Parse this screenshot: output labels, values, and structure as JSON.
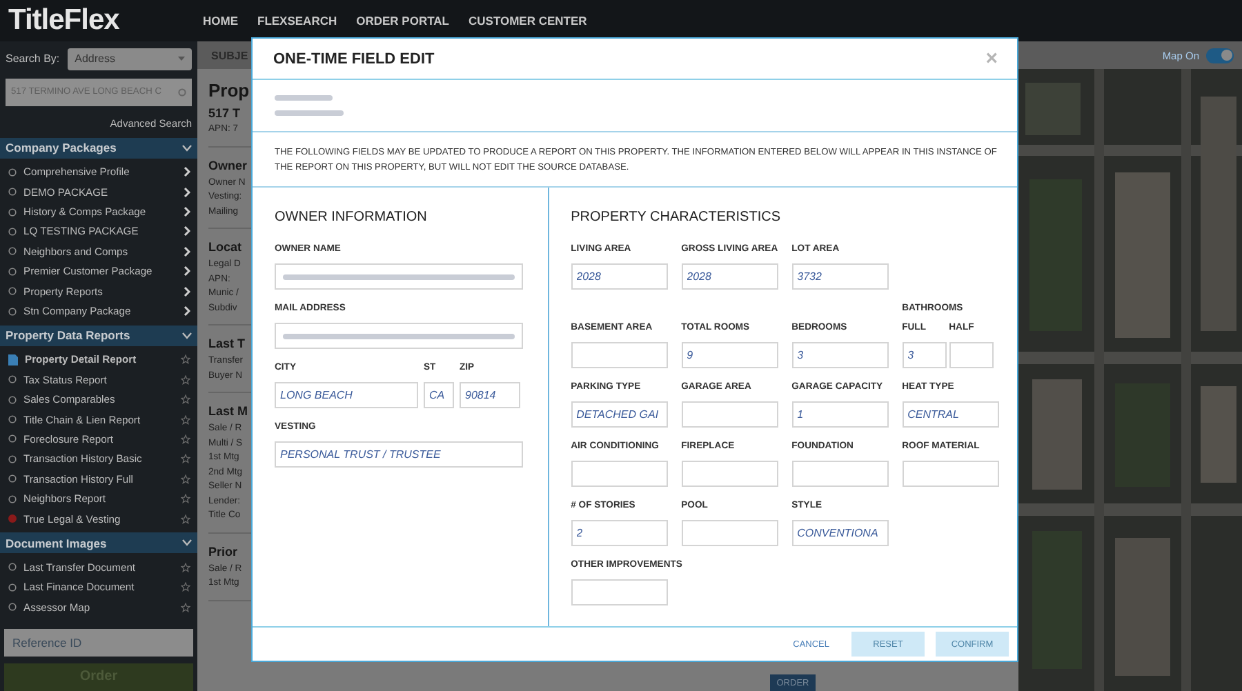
{
  "app": {
    "logo": "TitleFlex",
    "nav": [
      {
        "label": "HOME"
      },
      {
        "label": "FLEXSEARCH"
      },
      {
        "label": "ORDER PORTAL"
      },
      {
        "label": "CUSTOMER CENTER"
      }
    ]
  },
  "sidebar": {
    "search_by_label": "Search By:",
    "search_by": "Address",
    "search_value": "517 TERMINO AVE LONG BEACH C",
    "advanced_search": "Advanced Search",
    "sections": [
      {
        "title": "Company Packages",
        "expanded": true,
        "kind": "packages",
        "items": [
          {
            "label": "Comprehensive Profile",
            "kind": "circle",
            "selected": false
          },
          {
            "label": "DEMO PACKAGE",
            "kind": "circle",
            "selected": false
          },
          {
            "label": "History & Comps Package",
            "kind": "circle",
            "selected": false
          },
          {
            "label": "LQ TESTING PACKAGE",
            "kind": "circle",
            "selected": false
          },
          {
            "label": "Neighbors and Comps",
            "kind": "circle",
            "selected": false
          },
          {
            "label": "Premier Customer Package",
            "kind": "circle",
            "selected": false
          },
          {
            "label": "Property Reports",
            "kind": "circle",
            "selected": false
          },
          {
            "label": "Stn Company Package",
            "kind": "circle",
            "selected": false
          }
        ]
      },
      {
        "title": "Property Data Reports",
        "expanded": true,
        "kind": "reports",
        "items": [
          {
            "label": "Property Detail Report",
            "kind": "document",
            "selected": true
          },
          {
            "label": "Tax Status Report",
            "kind": "circle",
            "selected": false
          },
          {
            "label": "Sales Comparables",
            "kind": "circle",
            "selected": false
          },
          {
            "label": "Title Chain & Lien Report",
            "kind": "circle",
            "selected": false
          },
          {
            "label": "Foreclosure Report",
            "kind": "circle",
            "selected": false
          },
          {
            "label": "Transaction History Basic",
            "kind": "circle",
            "selected": false
          },
          {
            "label": "Transaction History Full",
            "kind": "circle",
            "selected": false
          },
          {
            "label": "Neighbors Report",
            "kind": "circle",
            "selected": false
          },
          {
            "label": "True Legal & Vesting",
            "kind": "alert",
            "selected": false
          }
        ]
      },
      {
        "title": "Document Images",
        "expanded": true,
        "kind": "reports",
        "items": [
          {
            "label": "Last Transfer Document",
            "kind": "circle",
            "selected": false
          },
          {
            "label": "Last Finance Document",
            "kind": "circle",
            "selected": false
          },
          {
            "label": "Assessor Map",
            "kind": "circle",
            "selected": false
          }
        ]
      }
    ],
    "reference_placeholder": "Reference ID",
    "order_button": "Order"
  },
  "subject_tab": "SUBJE",
  "map_toggle": {
    "label": "Map On",
    "on": true
  },
  "report_sections": [
    {
      "heading": "Prop",
      "kind": "title",
      "lines": [
        "517 T",
        "APN: 7"
      ]
    },
    {
      "heading": "Owner",
      "kind": "section",
      "lines": [
        "Owner N",
        "Vesting:",
        "Mailing"
      ]
    },
    {
      "heading": "Locat",
      "kind": "section",
      "lines": [
        "Legal D",
        "APN:",
        "Munic /",
        "Subdiv"
      ]
    },
    {
      "heading": "Last T",
      "kind": "section",
      "lines": [
        "Transfer",
        "Buyer N"
      ]
    },
    {
      "heading": "Last M",
      "kind": "section",
      "lines": [
        "Sale / R",
        "Multi / S",
        "1st Mtg",
        "2nd Mtg",
        "Seller N",
        "Lender:",
        "Title Co"
      ]
    },
    {
      "heading": "Prior",
      "kind": "section",
      "lines": [
        "Sale / R",
        "1st Mtg"
      ]
    }
  ],
  "bottom_button": "ORDER",
  "modal": {
    "title": "ONE-TIME FIELD EDIT",
    "close": "×",
    "address": [
      {
        "redacted": true
      },
      {
        "redacted": true
      }
    ],
    "notice": "THE FOLLOWING FIELDS MAY BE UPDATED TO PRODUCE A REPORT ON THIS PROPERTY. THE INFORMATION ENTERED BELOW WILL APPEAR IN THIS INSTANCE OF THE REPORT ON THIS PROPERTY, BUT WILL NOT EDIT THE SOURCE DATABASE.",
    "owner": {
      "title": "OWNER INFORMATION",
      "rows": [
        [
          {
            "label": "OWNER NAME",
            "kind": "full",
            "redacted": true
          }
        ],
        [
          {
            "label": "MAIL ADDRESS",
            "kind": "full",
            "redacted": true
          }
        ],
        [
          {
            "label": "CITY",
            "kind": "wide",
            "value": "LONG BEACH"
          },
          {
            "label": "ST",
            "kind": "tiny",
            "value": "CA"
          },
          {
            "label": "ZIP",
            "kind": "mid",
            "value": "90814"
          }
        ],
        [
          {
            "label": "VESTING",
            "kind": "full",
            "value": "PERSONAL TRUST / TRUSTEE"
          }
        ]
      ]
    },
    "property": {
      "title": "PROPERTY CHARACTERISTICS",
      "rows": [
        [
          {
            "kind": "field",
            "label": "LIVING AREA",
            "value": "2028"
          },
          {
            "kind": "field",
            "label": "GROSS LIVING AREA",
            "value": "2028"
          },
          {
            "kind": "field",
            "label": "LOT AREA",
            "value": "3732"
          }
        ],
        [
          {
            "kind": "field",
            "label": "BASEMENT AREA"
          },
          {
            "kind": "field",
            "label": "TOTAL ROOMS",
            "value": "9"
          },
          {
            "kind": "field",
            "label": "BEDROOMS",
            "value": "3"
          },
          {
            "kind": "group",
            "label": "BATHROOMS",
            "fields": [
              {
                "label": "FULL",
                "value": "3"
              },
              {
                "label": "HALF"
              }
            ]
          }
        ],
        [
          {
            "kind": "field",
            "label": "PARKING TYPE",
            "value": "DETACHED GAI"
          },
          {
            "kind": "field",
            "label": "GARAGE AREA"
          },
          {
            "kind": "field",
            "label": "GARAGE CAPACITY",
            "value": "1"
          },
          {
            "kind": "field",
            "label": "HEAT TYPE",
            "value": "CENTRAL"
          }
        ],
        [
          {
            "kind": "field",
            "label": "AIR CONDITIONING"
          },
          {
            "kind": "field",
            "label": "FIREPLACE"
          },
          {
            "kind": "field",
            "label": "FOUNDATION"
          },
          {
            "kind": "field",
            "label": "ROOF MATERIAL"
          }
        ],
        [
          {
            "kind": "field",
            "label": "# OF STORIES",
            "value": "2"
          },
          {
            "kind": "field",
            "label": "POOL"
          },
          {
            "kind": "field",
            "label": "STYLE",
            "value": "CONVENTIONA"
          }
        ],
        [
          {
            "kind": "field",
            "label": "OTHER IMPROVEMENTS"
          }
        ]
      ]
    },
    "buttons": [
      {
        "label": "CANCEL",
        "kind": "link",
        "disabled": false
      },
      {
        "label": "RESET",
        "kind": "button",
        "disabled": true
      },
      {
        "label": "CONFIRM",
        "kind": "button",
        "disabled": true
      }
    ]
  }
}
